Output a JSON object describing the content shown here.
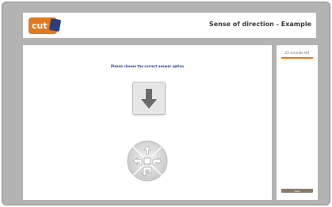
{
  "header": {
    "logo_text": "cut",
    "title": "Sense of direction - Example"
  },
  "main": {
    "prompt": "Please choose the correct answer option",
    "arrow_direction": "down",
    "footer_note": "..."
  },
  "sidebar": {
    "timer_text": "23 seconds left",
    "timer_fraction": 1.0,
    "next_label": "Next"
  },
  "colors": {
    "accent": "#e07a1f",
    "brand_blue": "#2b3f7f",
    "prompt_text": "#2f3e8f",
    "frame_bg": "#b3b3b3"
  }
}
